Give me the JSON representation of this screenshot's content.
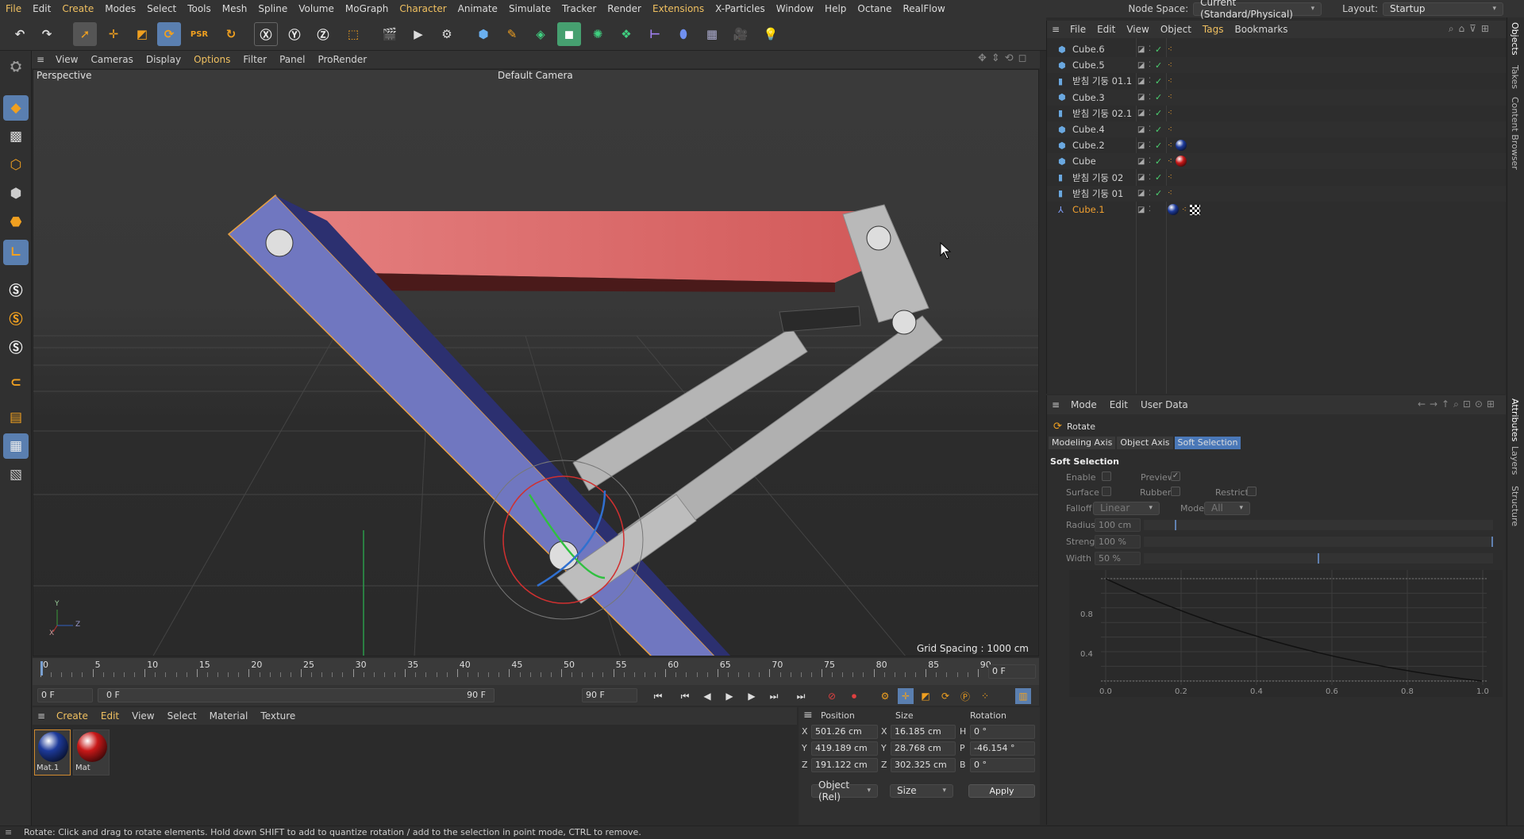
{
  "menu": [
    "File",
    "Edit",
    "Create",
    "Modes",
    "Select",
    "Tools",
    "Mesh",
    "Spline",
    "Volume",
    "MoGraph",
    "Character",
    "Animate",
    "Simulate",
    "Tracker",
    "Render",
    "Extensions",
    "X-Particles",
    "Window",
    "Help",
    "Octane",
    "RealFlow"
  ],
  "node_space_label": "Node Space:",
  "node_space_value": "Current (Standard/Physical)",
  "layout_label": "Layout:",
  "layout_value": "Startup",
  "viewport_menu": [
    "View",
    "Cameras",
    "Display",
    "Options",
    "Filter",
    "Panel",
    "ProRender"
  ],
  "viewport_name": "Perspective",
  "camera": "Default Camera",
  "grid_spacing": "Grid Spacing : 1000 cm",
  "axis_labels": {
    "y": "Y",
    "z": "Z",
    "x": "X"
  },
  "timeline_ticks": [
    "0",
    "5",
    "10",
    "15",
    "20",
    "25",
    "30",
    "35",
    "40",
    "45",
    "50",
    "55",
    "60",
    "65",
    "70",
    "75",
    "80",
    "85",
    "90"
  ],
  "frame_current": "0 F",
  "frame_start": "0 F",
  "frame_range_start": "0 F",
  "frame_range_end": "90 F",
  "frame_end": "90 F",
  "material_menu": [
    "Create",
    "Edit",
    "View",
    "Select",
    "Material",
    "Texture"
  ],
  "materials": [
    {
      "name": "Mat.1",
      "color": "#1d3a9a"
    },
    {
      "name": "Mat",
      "color": "#c81818"
    }
  ],
  "coord": {
    "headers": [
      "Position",
      "Size",
      "Rotation"
    ],
    "rows": [
      {
        "axis": "X",
        "pos": "501.26 cm",
        "saxis": "X",
        "size": "16.185 cm",
        "raxis": "H",
        "rot": "0 °"
      },
      {
        "axis": "Y",
        "pos": "419.189 cm",
        "saxis": "Y",
        "size": "28.768 cm",
        "raxis": "P",
        "rot": "-46.154 °"
      },
      {
        "axis": "Z",
        "pos": "191.122 cm",
        "saxis": "Z",
        "size": "302.325 cm",
        "raxis": "B",
        "rot": "0 °"
      }
    ],
    "mode": "Object (Rel)",
    "size_mode": "Size",
    "apply": "Apply"
  },
  "status": "Rotate: Click and drag to rotate elements. Hold down SHIFT to add to quantize rotation / add to the selection in point mode, CTRL to remove.",
  "obj_menu": [
    "File",
    "Edit",
    "View",
    "Object",
    "Tags",
    "Bookmarks"
  ],
  "objects": [
    {
      "name": "Cube.6",
      "type": "cube",
      "tags": [
        "dot"
      ]
    },
    {
      "name": "Cube.5",
      "type": "cube",
      "tags": [
        "dot"
      ]
    },
    {
      "name": "받침 기둥 01.1",
      "type": "poly",
      "tags": [
        "dot"
      ]
    },
    {
      "name": "Cube.3",
      "type": "cube",
      "tags": [
        "dot"
      ]
    },
    {
      "name": "받침 기둥 02.1",
      "type": "poly",
      "tags": [
        "dot"
      ]
    },
    {
      "name": "Cube.4",
      "type": "cube",
      "tags": [
        "dot"
      ]
    },
    {
      "name": "Cube.2",
      "type": "cube",
      "tags": [
        "dot",
        "blue"
      ]
    },
    {
      "name": "Cube",
      "type": "cube",
      "tags": [
        "dot",
        "red"
      ]
    },
    {
      "name": "받침 기둥 02",
      "type": "poly",
      "tags": [
        "dot"
      ]
    },
    {
      "name": "받침 기둥 01",
      "type": "poly",
      "tags": [
        "dot"
      ]
    },
    {
      "name": "Cube.1",
      "type": "joint",
      "tags": [
        "blue",
        "dot",
        "checker"
      ],
      "selected": true
    }
  ],
  "attr_menu": [
    "Mode",
    "Edit",
    "User Data"
  ],
  "tool_name": "Rotate",
  "attr_tabs": [
    "Modeling Axis",
    "Object Axis",
    "Soft Selection"
  ],
  "attr_section": "Soft Selection",
  "soft": {
    "enable": "Enable",
    "preview": "Preview",
    "surface": "Surface",
    "rubber": "Rubber",
    "restrict": "Restrict",
    "falloff_label": "Falloff",
    "falloff": "Linear",
    "mode_label": "Mode",
    "mode": "All",
    "radius_label": "Radius",
    "radius": "100 cm",
    "strength_label": "Strength",
    "strength": "100 %",
    "width_label": "Width . .",
    "width": "50 %",
    "radius_level": 0.09,
    "strength_level": 1.0,
    "width_level": 0.5
  },
  "graph": {
    "y_ticks": [
      "0.8",
      "0.4"
    ],
    "x_ticks": [
      "0.0",
      "0.2",
      "0.4",
      "0.6",
      "0.8",
      "1.0"
    ]
  },
  "right_tabs": [
    "Objects",
    "Takes",
    "Content Browser",
    "Attributes",
    "Layers",
    "Structure"
  ]
}
